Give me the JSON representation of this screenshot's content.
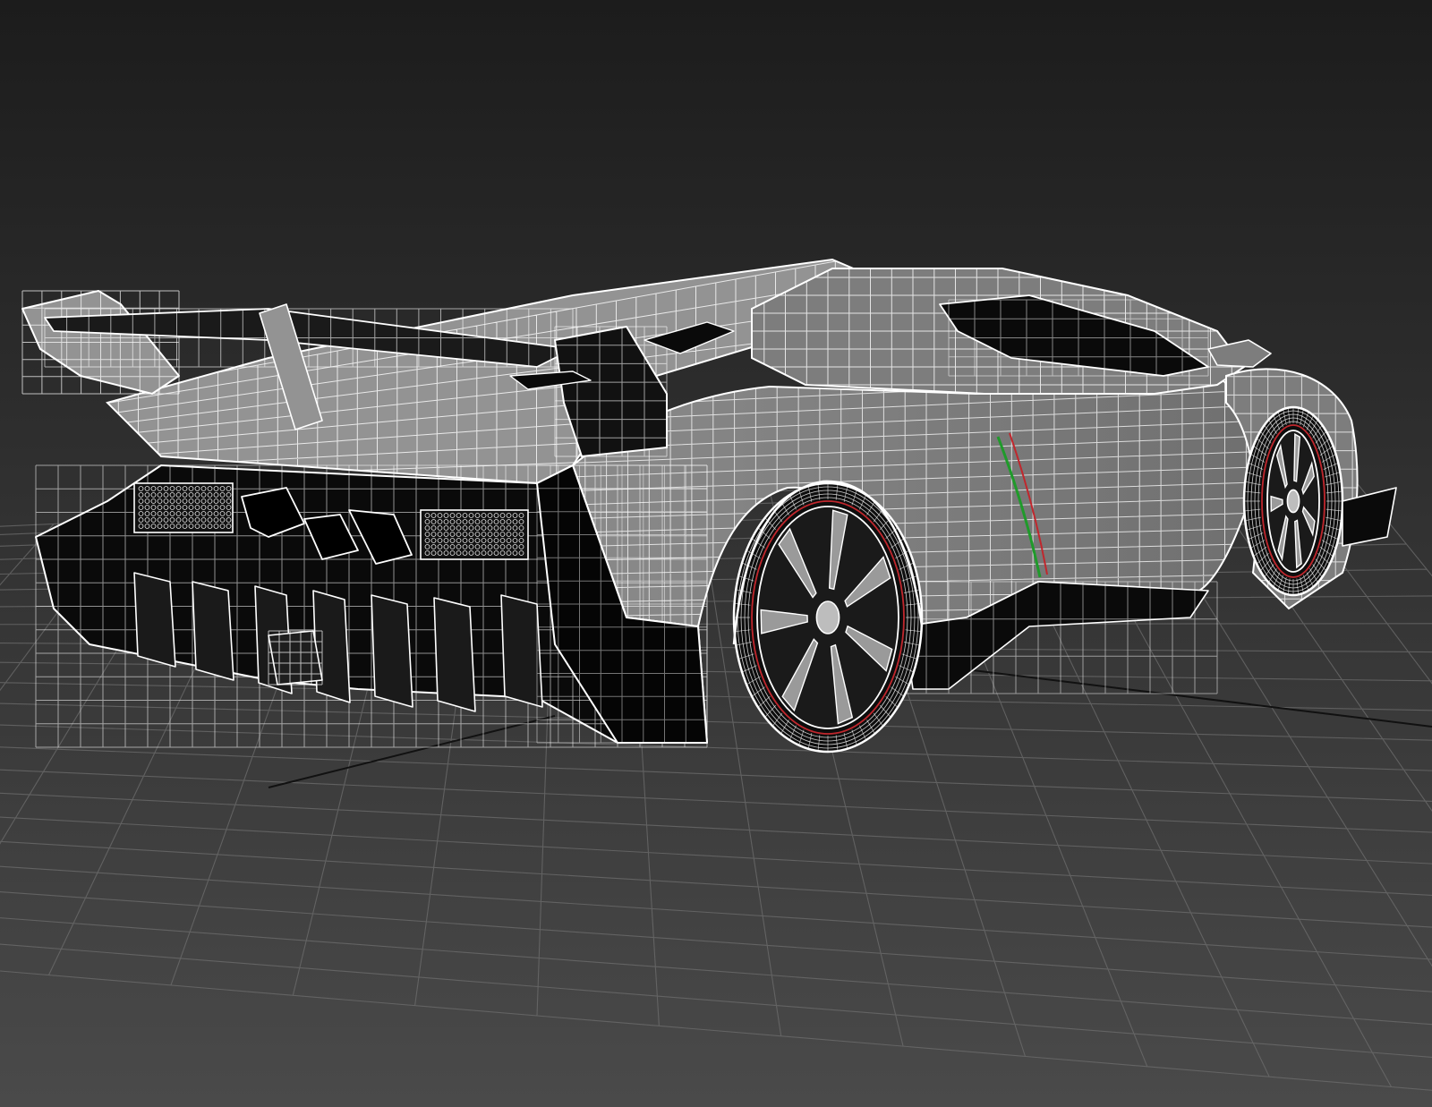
{
  "viewport": {
    "background_top": "#1c1c1c",
    "background_bottom": "#4a4a4a",
    "grid_color": "#6e6e6e",
    "axis_color": "#111111",
    "wire_color": "#ffffff",
    "body_fill": "#7d7d7d",
    "body_fill_light": "#939393",
    "dark_fill": "#0a0a0a",
    "accent_green": "#1f9a2a",
    "accent_red": "#c0272d"
  },
  "scene": {
    "object": "wireframe-sports-car",
    "view": "rear-three-quarter-perspective",
    "display_mode": "wireframe-on-shaded"
  }
}
